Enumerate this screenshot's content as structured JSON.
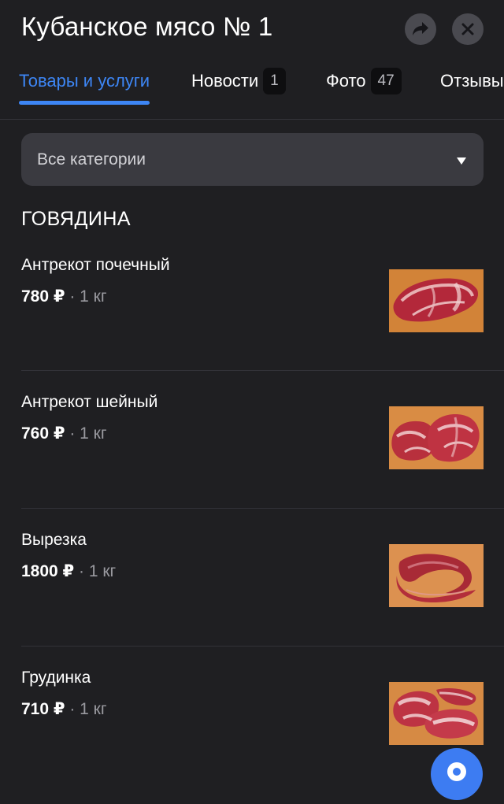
{
  "header": {
    "title": "Кубанское мясо № 1",
    "share_icon": "share-arrow-icon",
    "close_icon": "close-x-icon"
  },
  "tabs": [
    {
      "label": "Товары и услуги",
      "badge": null,
      "active": true
    },
    {
      "label": "Новости",
      "badge": "1",
      "active": false
    },
    {
      "label": "Фото",
      "badge": "47",
      "active": false
    },
    {
      "label": "Отзывы",
      "badge": null,
      "active": false
    }
  ],
  "filter": {
    "label": "Все категории",
    "icon": "dropdown-triangle-icon"
  },
  "section": {
    "title": "ГОВЯДИНА"
  },
  "products": [
    {
      "name": "Антрекот почечный",
      "price": "780 ₽",
      "unit": " · 1 кг",
      "image": "beef-rib-steak-photo"
    },
    {
      "name": "Антрекот шейный",
      "price": "760 ₽",
      "unit": " · 1 кг",
      "image": "beef-neck-steak-photo"
    },
    {
      "name": "Вырезка",
      "price": "1800 ₽",
      "unit": " · 1 кг",
      "image": "beef-tenderloin-photo"
    },
    {
      "name": "Грудинка",
      "price": "710 ₽",
      "unit": " · 1 кг",
      "image": "beef-brisket-photo"
    }
  ],
  "fab": {
    "icon": "location-pin-icon"
  },
  "colors": {
    "background": "#1f1f22",
    "accent": "#3d86f5",
    "dropdown_bg": "#3a3a40",
    "badge_bg": "#0e0e10",
    "muted_text": "#9a9aa0"
  }
}
